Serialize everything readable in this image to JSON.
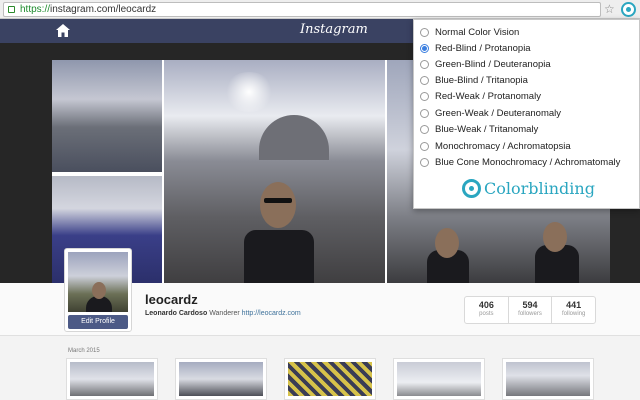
{
  "browser": {
    "url_scheme": "https://",
    "url_rest": "instagram.com/leocardz"
  },
  "header": {
    "logo": "Instagram"
  },
  "profile": {
    "username": "leocardz",
    "full_name": "Leonardo Cardoso",
    "bio_text": "Wanderer",
    "website": "http://leocardz.com",
    "edit_label": "Edit Profile",
    "stats": [
      {
        "value": "406",
        "label": "posts"
      },
      {
        "value": "594",
        "label": "followers"
      },
      {
        "value": "441",
        "label": "following"
      }
    ]
  },
  "feed": {
    "month_label": "March 2015"
  },
  "popup": {
    "selected": "Red-Blind / Protanopia",
    "options": [
      "Normal Color Vision",
      "Red-Blind / Protanopia",
      "Green-Blind / Deuteranopia",
      "Blue-Blind / Tritanopia",
      "Red-Weak / Protanomaly",
      "Green-Weak / Deuteranomaly",
      "Blue-Weak / Tritanomaly",
      "Monochromacy / Achromatopsia",
      "Blue Cone Monochromacy / Achromatomaly"
    ],
    "brand": "Colorblinding",
    "accent_color": "#2aa6c0"
  },
  "colors": {
    "header_bg": "#3a4262",
    "link": "#3f729b",
    "edit_button": "#4c5a86"
  }
}
